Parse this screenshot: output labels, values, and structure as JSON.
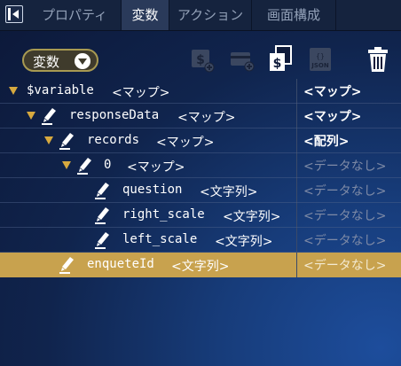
{
  "tabs": [
    {
      "label": "プロパティ",
      "active": false
    },
    {
      "label": "変数",
      "active": true
    },
    {
      "label": "アクション",
      "active": false
    },
    {
      "label": "画面構成",
      "active": false
    }
  ],
  "toolbar": {
    "dropdown_label": "変数",
    "icons": [
      "add-dollar-icon",
      "add-card-icon",
      "copy-dollar-icon",
      "json-icon",
      "trash-icon"
    ]
  },
  "tree": {
    "rows": [
      {
        "name": "$variable",
        "type": "<マップ>",
        "value": "<マップ>",
        "has_arrow": true,
        "has_pen": false
      },
      {
        "name": "responseData",
        "type": "<マップ>",
        "value": "<マップ>",
        "has_arrow": true,
        "has_pen": true
      },
      {
        "name": "records",
        "type": "<マップ>",
        "value": "<配列>",
        "has_arrow": true,
        "has_pen": true
      },
      {
        "name": "0",
        "type": "<マップ>",
        "value": "<データなし>",
        "has_arrow": true,
        "has_pen": true
      },
      {
        "name": "question",
        "type": "<文字列>",
        "value": "<データなし>",
        "has_arrow": false,
        "has_pen": true
      },
      {
        "name": "right_scale",
        "type": "<文字列>",
        "value": "<データなし>",
        "has_arrow": false,
        "has_pen": true
      },
      {
        "name": "left_scale",
        "type": "<文字列>",
        "value": "<データなし>",
        "has_arrow": false,
        "has_pen": true
      },
      {
        "name": "enqueteId",
        "type": "<文字列>",
        "value": "<データなし>",
        "has_arrow": false,
        "has_pen": true,
        "selected": true
      }
    ]
  },
  "colors": {
    "accent_gold": "#c8a24e",
    "arrow": "#d7a93f",
    "empty_value": "#7e8aa6"
  }
}
